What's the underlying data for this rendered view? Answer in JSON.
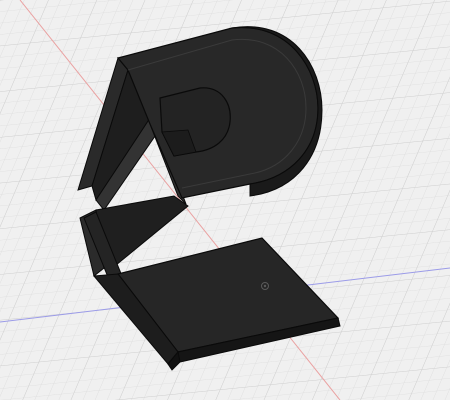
{
  "viewport": {
    "background": "#f0f0f0",
    "grid_minor_color": "#dddddd",
    "grid_major_color": "#cfcfcf",
    "axis_x_color": "#e89b9b",
    "axis_y_color": "#8a8ae6",
    "model_color": "#262626",
    "model_edge_color": "#0a0a0a",
    "origin_marker_icon": "origin-point-icon"
  },
  "model": {
    "name": "",
    "parts": [
      "stand-base-plate",
      "stand-upright-arm",
      "stand-rear-support",
      "stand-round-head",
      "head-cutout-pocket"
    ]
  }
}
